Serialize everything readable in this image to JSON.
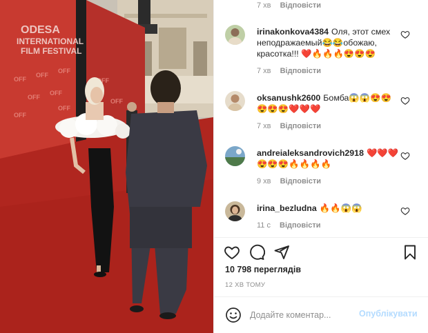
{
  "comments": [
    {
      "time": "7 хв",
      "reply": "Відповісти"
    },
    {
      "username": "irinakonkova4384",
      "text": "Оля, этот смех неподражаемый😂😂обожаю, красотка!!! ❤️🔥🔥🔥😍😍😍",
      "time": "7 хв",
      "reply": "Відповісти"
    },
    {
      "username": "oksanushk2600",
      "text": "Бомба😱😱😍😍😍😍😍❤️❤️❤️",
      "time": "7 хв",
      "reply": "Відповісти"
    },
    {
      "username": "andreialeksandrovich2918",
      "text": "❤️❤️❤️😍😍😍🔥🔥🔥🔥",
      "time": "9 хв",
      "reply": "Відповісти"
    },
    {
      "username": "irina_bezludna",
      "text": "🔥🔥😱😱",
      "time": "11 с",
      "reply": "Відповісти"
    }
  ],
  "likes_text": "10 798 переглядів",
  "timestamp": "12 ХВ ТОМУ",
  "add_comment": {
    "placeholder": "Додайте коментар..."
  },
  "publish_label": "Опублікувати",
  "media": {
    "banner_lines": [
      "ODESA",
      "INTERNATIONAL",
      "FILM FESTIVAL"
    ],
    "logo": "OFF"
  },
  "colors": {
    "carpet": "#b0261f",
    "link_disabled": "#b3dbff",
    "muted": "#8e8e8e"
  },
  "icons": [
    "heart-icon",
    "comment-icon",
    "share-icon",
    "bookmark-icon",
    "emoji-icon"
  ]
}
